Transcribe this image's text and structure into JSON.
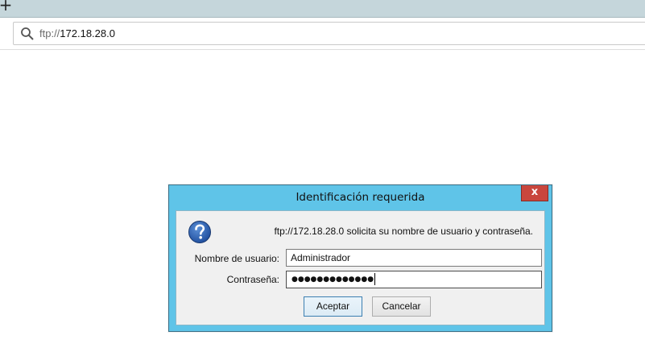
{
  "browser": {
    "new_tab_symbol": "+",
    "url_scheme": "ftp://",
    "url_host": "172.18.28.0",
    "icons": {
      "search": "search-icon",
      "new_tab": "plus-icon"
    }
  },
  "dialog": {
    "title": "Identificación requerida",
    "close_symbol": "x",
    "prompt": "ftp://172.18.28.0 solicita su nombre de usuario y contraseña.",
    "icon": "question-icon",
    "username_label": "Nombre de usuario:",
    "username_value": "Administrador",
    "password_label": "Contraseña:",
    "password_masked": "●●●●●●●●●●●●●",
    "ok_label": "Aceptar",
    "cancel_label": "Cancelar",
    "colors": {
      "frame": "#5fc4e8",
      "close": "#c9463d",
      "body": "#f0f0f0"
    }
  }
}
